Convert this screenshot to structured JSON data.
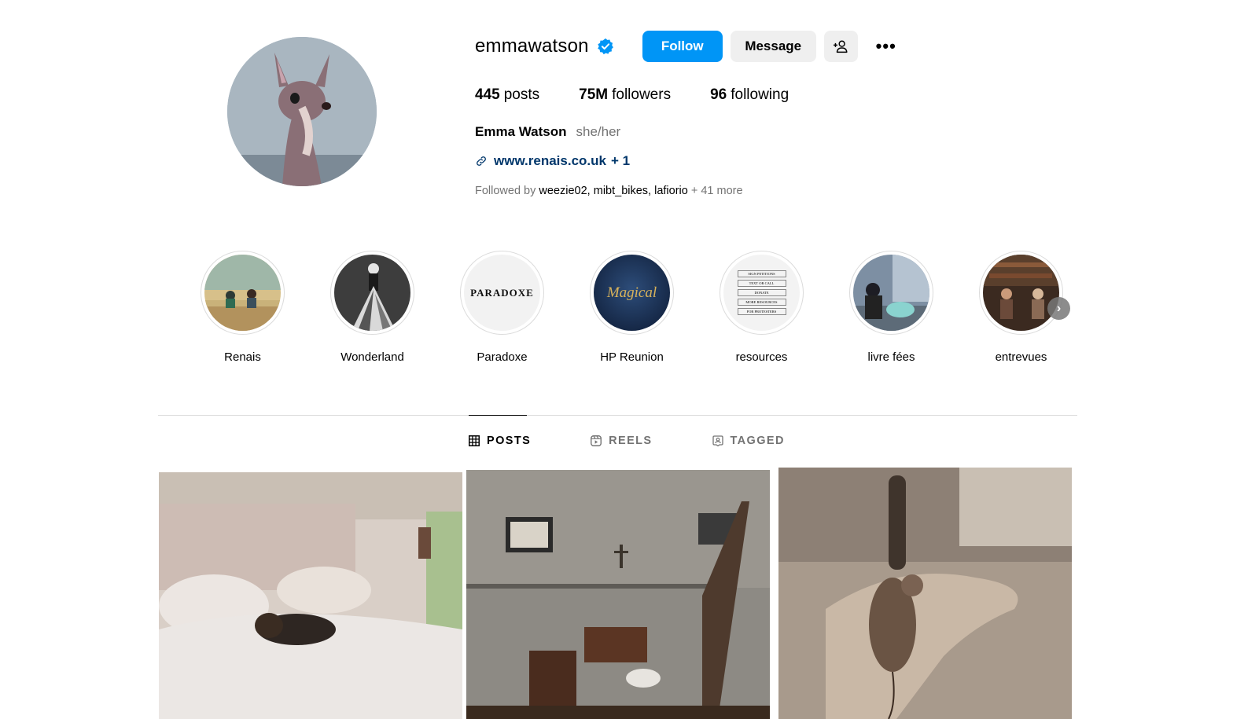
{
  "profile": {
    "username": "emmawatson",
    "verified": true,
    "buttons": {
      "follow": "Follow",
      "message": "Message",
      "add_user_icon": "person-add-icon",
      "more_icon": "more-horizontal-icon",
      "more_label": "•••"
    },
    "stats": [
      {
        "value": "445",
        "label": "posts"
      },
      {
        "value": "75M",
        "label": "followers"
      },
      {
        "value": "96",
        "label": "following"
      }
    ],
    "full_name": "Emma Watson",
    "pronouns": "she/her",
    "link": {
      "text": "www.renais.co.uk",
      "more": "+ 1"
    },
    "followed_by": {
      "prefix": "Followed by",
      "names": [
        "weezie02",
        "mibt_bikes",
        "lafiorio"
      ],
      "sep1": ", ",
      "sep2": ", ",
      "suffix": "+ 41 more"
    }
  },
  "highlights": [
    {
      "label": "Renais"
    },
    {
      "label": "Wonderland"
    },
    {
      "label": "Paradoxe",
      "cover_text": "PARADOXE"
    },
    {
      "label": "HP Reunion",
      "cover_text": "Magical"
    },
    {
      "label": "resources",
      "cover_items": [
        "SIGN PETITIONS",
        "TEXT OR CALL",
        "DONATE",
        "MORE RESOURCES",
        "FOR PROTESTERS"
      ]
    },
    {
      "label": "livre fées"
    },
    {
      "label": "entrevues"
    }
  ],
  "highlights_next_icon": "chevron-right-icon",
  "tabs": [
    {
      "label": "POSTS",
      "icon": "grid-icon",
      "active": true
    },
    {
      "label": "REELS",
      "icon": "reels-icon",
      "active": false
    },
    {
      "label": "TAGGED",
      "icon": "tagged-icon",
      "active": false
    }
  ],
  "colors": {
    "accent": "#0095f6",
    "button_bg": "#efefef",
    "link": "#00376b",
    "muted": "#737373"
  }
}
